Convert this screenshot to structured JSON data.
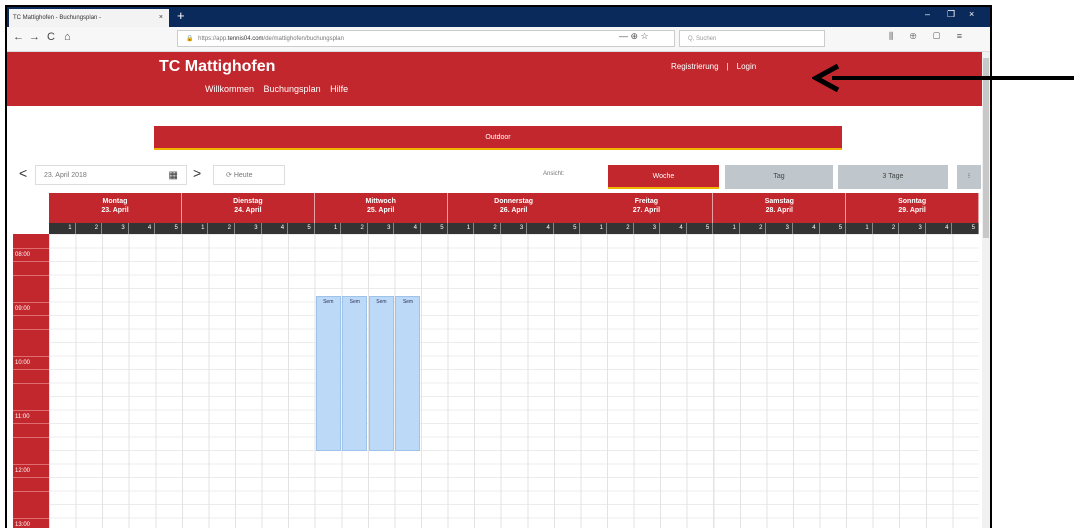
{
  "browser": {
    "tab_title": "TC Mattighofen - Buchungsplan - ",
    "tab_close": "×",
    "new_tab": "+",
    "window_controls": [
      "–",
      "❐",
      "×"
    ],
    "nav": [
      "←",
      "→",
      "C",
      "⌂"
    ],
    "url_prefix": "https://app.",
    "url_domain": "tennis04.com",
    "url_path": "/de/mattighofen/buchungsplan",
    "url_icons": "— ⊕ ☆",
    "search_placeholder": "Q, Suchen",
    "toolbar_icons": "⫼ ⊕ ▢ ≡"
  },
  "site": {
    "title": "TC Mattighofen",
    "nav": [
      "Willkommen",
      "Buchungsplan",
      "Hilfe"
    ],
    "auth": {
      "register": "Registrierung",
      "separator": "|",
      "login": "Login"
    }
  },
  "outdoor_label": "Outdoor",
  "controls": {
    "prev": "<",
    "next": ">",
    "date": "23. April 2018",
    "today": "Heute",
    "ansicht": "Ansicht:",
    "views": {
      "week": "Woche",
      "day": "Tag",
      "three_days": "3 Tage",
      "more": "⁝"
    }
  },
  "days": [
    {
      "name": "Montag",
      "date": "23. April"
    },
    {
      "name": "Dienstag",
      "date": "24. April"
    },
    {
      "name": "Mittwoch",
      "date": "25. April"
    },
    {
      "name": "Donnerstag",
      "date": "26. April"
    },
    {
      "name": "Freitag",
      "date": "27. April"
    },
    {
      "name": "Samstag",
      "date": "28. April"
    },
    {
      "name": "Sonntag",
      "date": "29. April"
    }
  ],
  "courts": [
    "1",
    "2",
    "3",
    "4",
    "5"
  ],
  "times": [
    "08:00",
    "09:00",
    "10:00",
    "11:00",
    "12:00",
    "13:00"
  ],
  "bookings": {
    "label": "Sem",
    "day": "Mittwoch",
    "courts": [
      "1",
      "2",
      "3",
      "4"
    ],
    "time": "09:00–11:45"
  },
  "colors": {
    "brand": "#c1272d",
    "accent": "#f0b400",
    "booking": "#bcd9f7",
    "view_inactive": "#bfc7cc"
  }
}
